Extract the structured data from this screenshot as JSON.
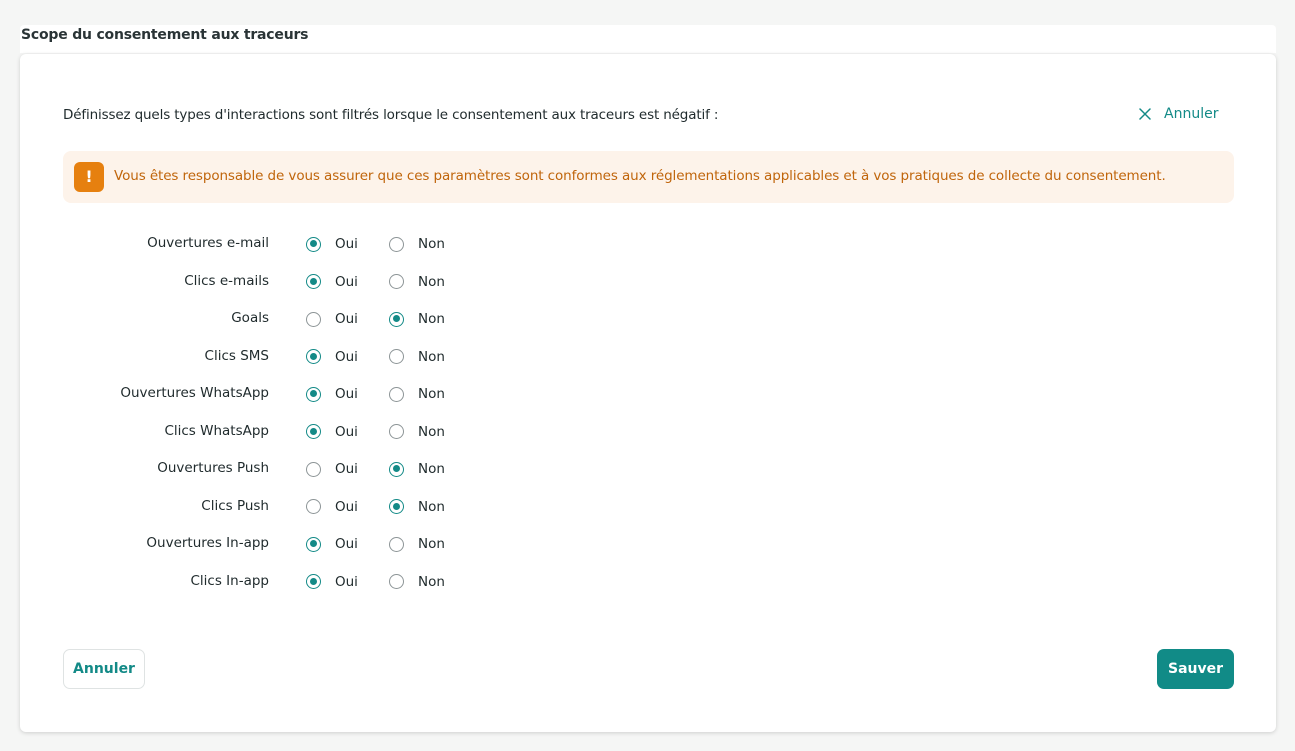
{
  "section": {
    "title": "Scope du consentement aux traceurs"
  },
  "card": {
    "intro": "Définissez quels types d'interactions sont filtrés lorsque le consentement aux traceurs est négatif :",
    "top_cancel_label": "Annuler",
    "warning": {
      "icon": "!",
      "text": "Vous êtes responsable de vous assurer que ces paramètres sont conformes aux réglementations applicables et à vos pratiques de collecte du consentement."
    },
    "option_yes": "Oui",
    "option_no": "Non",
    "rows": [
      {
        "label": "Ouvertures e-mail",
        "value": "Oui"
      },
      {
        "label": "Clics e-mails",
        "value": "Oui"
      },
      {
        "label": "Goals",
        "value": "Non"
      },
      {
        "label": "Clics SMS",
        "value": "Oui"
      },
      {
        "label": "Ouvertures WhatsApp",
        "value": "Oui"
      },
      {
        "label": "Clics WhatsApp",
        "value": "Oui"
      },
      {
        "label": "Ouvertures Push",
        "value": "Non"
      },
      {
        "label": "Clics Push",
        "value": "Non"
      },
      {
        "label": "Ouvertures In-app",
        "value": "Oui"
      },
      {
        "label": "Clics In-app",
        "value": "Oui"
      }
    ],
    "cancel_button": "Annuler",
    "save_button": "Sauver"
  },
  "colors": {
    "accent": "#138a87",
    "warning_bg": "#fdf3ea",
    "warning_text": "#c0650b",
    "warning_icon": "#e6800f"
  }
}
